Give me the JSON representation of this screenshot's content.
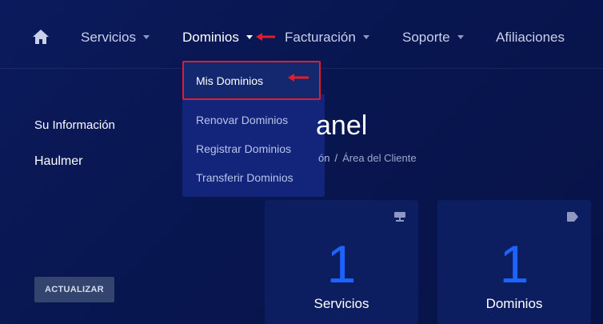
{
  "nav": {
    "home_icon": "home-icon",
    "items": [
      {
        "label": "Servicios",
        "has_dropdown": true
      },
      {
        "label": "Dominios",
        "has_dropdown": true,
        "active": true
      },
      {
        "label": "Facturación",
        "has_dropdown": true
      },
      {
        "label": "Soporte",
        "has_dropdown": true
      },
      {
        "label": "Afiliaciones",
        "has_dropdown": false
      }
    ]
  },
  "dropdown": {
    "items": [
      {
        "label": "Mis Dominios",
        "highlighted": true
      },
      {
        "label": "Renovar Dominios"
      },
      {
        "label": "Registrar Dominios"
      },
      {
        "label": "Transferir Dominios"
      }
    ]
  },
  "sidebar": {
    "title": "Su Información",
    "name": "Haulmer",
    "update_button": "ACTUALIZAR"
  },
  "main": {
    "title_visible": "anel",
    "breadcrumb": {
      "previous_partial": "ón",
      "separator": "/",
      "current": "Área del Cliente"
    }
  },
  "tiles": [
    {
      "number": "1",
      "label": "Servicios",
      "icon": "server-icon"
    },
    {
      "number": "1",
      "label": "Dominios",
      "icon": "tag-icon"
    }
  ],
  "colors": {
    "background": "#0b1a5c",
    "accent_number": "#1d64ff",
    "annotation_red": "#e21d2a",
    "dropdown_bg": "#13257a",
    "button_bg": "#33456f"
  }
}
